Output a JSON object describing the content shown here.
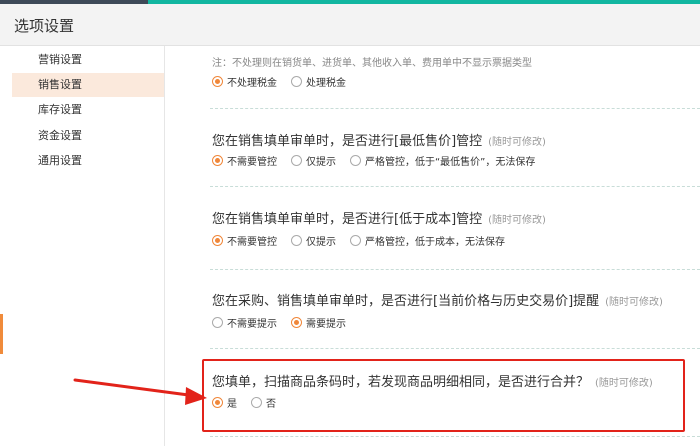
{
  "window": {
    "title": "选项设置"
  },
  "sidebar": {
    "items": [
      {
        "label": "营销设置",
        "active": false
      },
      {
        "label": "销售设置",
        "active": true
      },
      {
        "label": "库存设置",
        "active": false
      },
      {
        "label": "资金设置",
        "active": false
      },
      {
        "label": "通用设置",
        "active": false
      }
    ]
  },
  "main": {
    "tax_note": "注：不处理则在销货单、进货单、其他收入单、费用单中不显示票据类型",
    "tax_options": [
      {
        "label": "不处理税金",
        "selected": true
      },
      {
        "label": "处理税金",
        "selected": false
      }
    ],
    "sections": [
      {
        "question": "您在销售填单审单时，是否进行[最低售价]管控",
        "hint": "(随时可修改)",
        "options": [
          {
            "label": "不需要管控",
            "selected": true
          },
          {
            "label": "仅提示",
            "selected": false
          },
          {
            "label": "严格管控，低于“最低售价”，无法保存",
            "selected": false
          }
        ]
      },
      {
        "question": "您在销售填单审单时，是否进行[低于成本]管控",
        "hint": "(随时可修改)",
        "options": [
          {
            "label": "不需要管控",
            "selected": true
          },
          {
            "label": "仅提示",
            "selected": false
          },
          {
            "label": "严格管控，低于成本，无法保存",
            "selected": false
          }
        ]
      },
      {
        "question": "您在采购、销售填单审单时，是否进行[当前价格与历史交易价]提醒",
        "hint": "(随时可修改)",
        "options": [
          {
            "label": "不需要提示",
            "selected": false
          },
          {
            "label": "需要提示",
            "selected": true
          }
        ]
      },
      {
        "question": "您填单，扫描商品条码时，若发现商品明细相同，是否进行合并？",
        "hint": "(随时可修改)",
        "options": [
          {
            "label": "是",
            "selected": true
          },
          {
            "label": "否",
            "selected": false
          }
        ]
      }
    ]
  },
  "colors": {
    "accent": "#f0873a",
    "topbar": "#11b6a0",
    "highlight": "#e2231a",
    "active_nav_bg": "#fbe9dc"
  }
}
